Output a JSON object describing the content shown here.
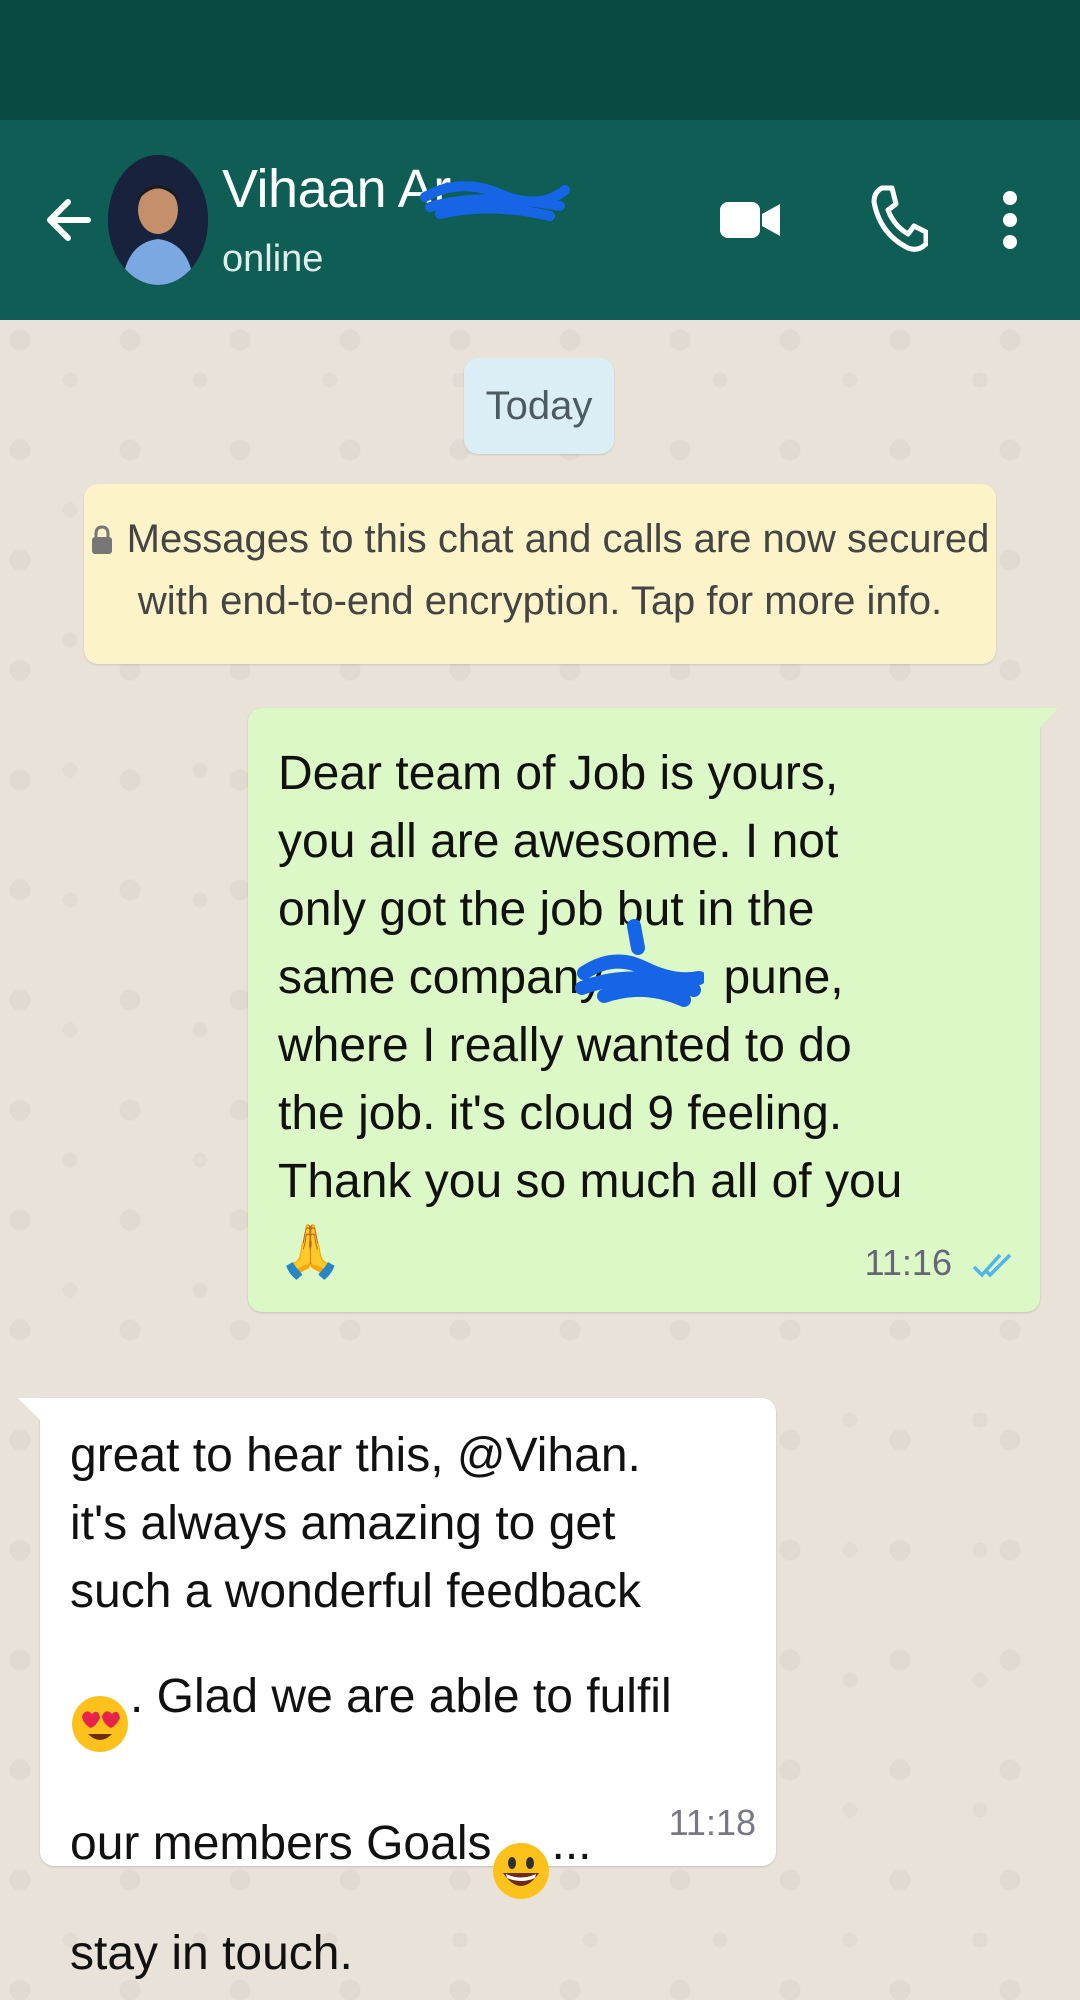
{
  "header": {
    "contact_name": "Vihaan Ar",
    "status": "online"
  },
  "chat": {
    "date_label": "Today",
    "encryption_notice": "Messages to this chat and calls are now secured\nwith end-to-end encryption. Tap for more info."
  },
  "messages": [
    {
      "direction": "outgoing",
      "text_before": "Dear team of Job is yours,\nyou all are awesome. I not\nonly got the job but in the\nsame company",
      "text_after": "pune,\nwhere I really wanted to do\nthe job. it's cloud 9 feeling.\nThank you so much all of you",
      "emoji": "🙏",
      "time": "11:16",
      "status": "read"
    },
    {
      "direction": "incoming",
      "line1": "great to hear this, @Vihan.",
      "line2": "it's always amazing to get",
      "line3": "such a wonderful feedback",
      "line4_after_emoji": ". Glad we are able to fulfil",
      "line5_before_emoji": "our members Goals",
      "line5_after_emoji": "...",
      "line6": "stay in touch.",
      "time": "11:18"
    }
  ],
  "colors": {
    "header": "#0e5e55",
    "status_bar": "#0b4a43",
    "outgoing_bubble": "#dcf8c6",
    "incoming_bubble": "#ffffff",
    "read_ticks": "#4fb6ec",
    "encryption_banner": "#fcf4c8",
    "date_pill": "#dbeef6"
  },
  "icons": [
    "back-arrow-icon",
    "video-call-icon",
    "phone-icon",
    "more-options-icon",
    "lock-icon",
    "read-ticks-icon"
  ]
}
